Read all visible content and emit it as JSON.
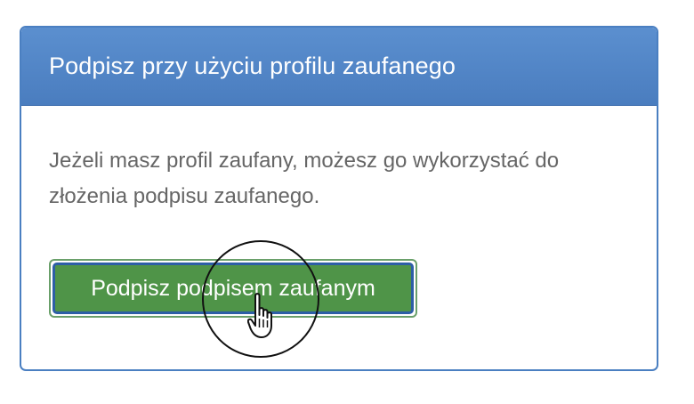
{
  "panel": {
    "title": "Podpisz przy użyciu profilu zaufanego",
    "description": "Jeżeli masz profil zaufany, możesz go wykorzystać do złożenia podpisu zaufanego.",
    "sign_button_label": "Podpisz podpisem zaufanym"
  },
  "colors": {
    "header_blue": "#4a7dbf",
    "button_green": "#4f9448",
    "button_focus_border": "#2d5fa6",
    "text_gray": "#666666"
  },
  "cursor": {
    "icon": "hand-pointer-icon"
  }
}
